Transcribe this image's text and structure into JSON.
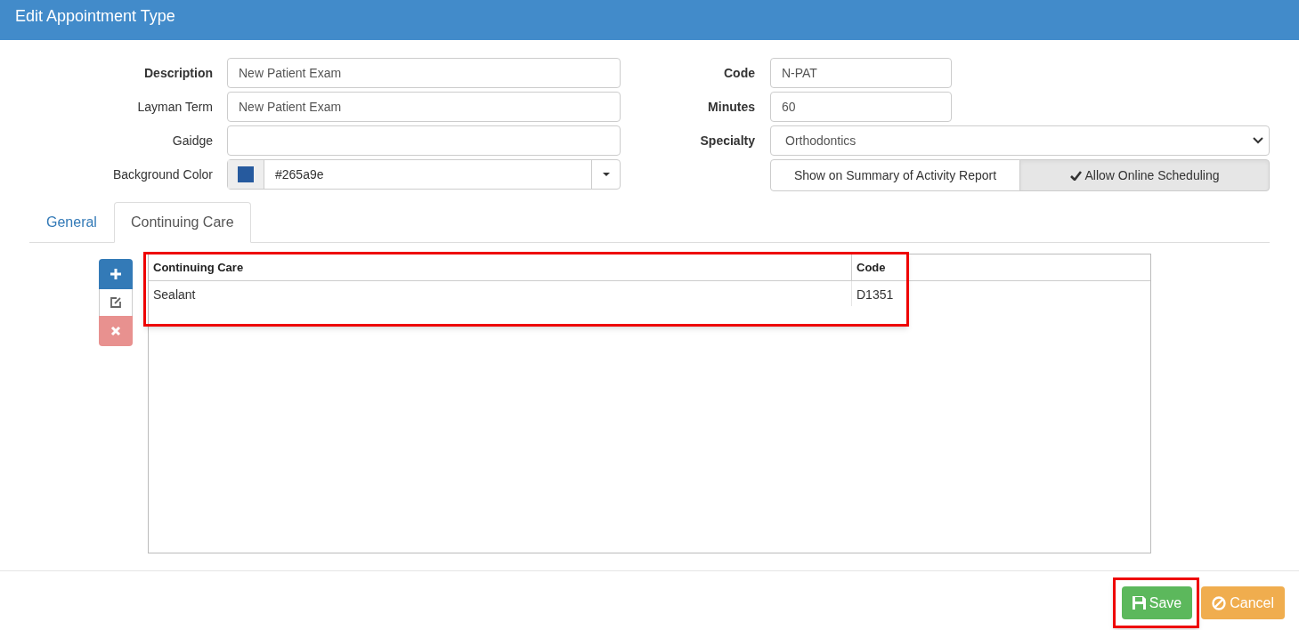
{
  "window": {
    "title": "Edit Appointment Type"
  },
  "left_fields": [
    {
      "label": "Description",
      "bold": true,
      "kind": "text",
      "value": "New Patient Exam"
    },
    {
      "label": "Layman Term",
      "bold": false,
      "kind": "text",
      "value": "New Patient Exam"
    },
    {
      "label": "Gaidge",
      "bold": false,
      "kind": "text"
    },
    {
      "label": "Background Color",
      "bold": false,
      "kind": "color",
      "value": "#265a9e",
      "color": "#265a9e"
    }
  ],
  "right_fields": [
    {
      "label": "Code",
      "kind": "short",
      "value": "N-PAT"
    },
    {
      "label": "Minutes",
      "kind": "short",
      "value": "60"
    },
    {
      "label": "Specialty",
      "kind": "select",
      "value": "Orthodontics"
    }
  ],
  "toggles": [
    {
      "label": "Show on Summary of Activity Report",
      "on": false
    },
    {
      "label": "Allow Online Scheduling",
      "on": true
    }
  ],
  "tabs": [
    {
      "label": "General",
      "selected": false
    },
    {
      "label": "Continuing Care",
      "selected": true
    }
  ],
  "table": {
    "highlighted": true,
    "columns": [
      "Continuing Care",
      "Code"
    ],
    "rows": [
      [
        "Sealant",
        "D1351"
      ]
    ]
  },
  "buttons": [
    {
      "label": "Save",
      "kind": "save",
      "highlighted": true
    },
    {
      "label": "Cancel",
      "kind": "cancel",
      "highlighted": false
    }
  ]
}
